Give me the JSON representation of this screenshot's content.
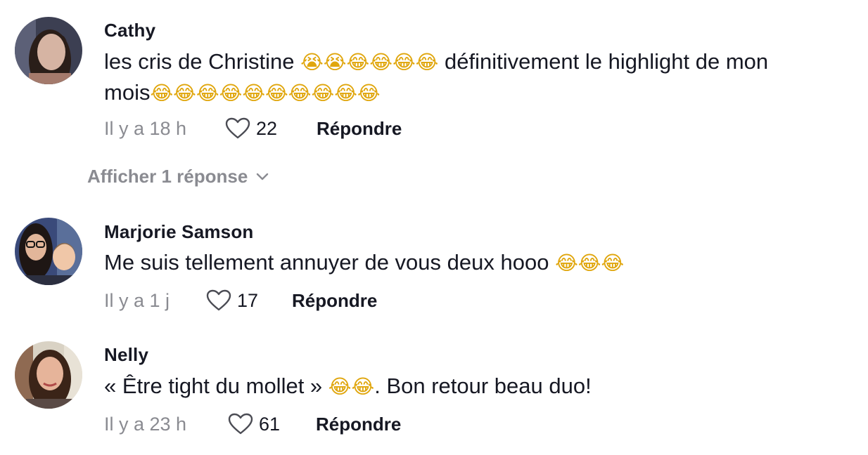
{
  "comments": [
    {
      "username": "Cathy",
      "text_line1": "les cris de Christine ",
      "emojis_a": "😭😭😂😂😂😂",
      "text_line1b": " définitivement le highlight de mon",
      "text_line2": "mois",
      "emojis_b": "😂😂😂😂😂😂😂😂😂😂",
      "time": "Il y a 18 h",
      "likes": "22",
      "reply": "Répondre"
    },
    {
      "username": "Marjorie Samson",
      "text": "Me suis tellement annuyer de vous deux hooo ",
      "emojis": "😂😂😂",
      "time": "Il y a 1 j",
      "likes": "17",
      "reply": "Répondre"
    },
    {
      "username": "Nelly",
      "text": "« Être tight du mollet » ",
      "emojis": "😂😂",
      "text_after": ". Bon retour beau duo!",
      "time": "Il y a 23 h",
      "likes": "61",
      "reply": "Répondre"
    }
  ],
  "show_replies": "Afficher 1 réponse",
  "icons": {
    "like": "heart-outline-icon",
    "expand": "chevron-down-icon"
  },
  "colors": {
    "text": "#161823",
    "secondary": "#8a8b91",
    "emoji": "#e0a60d"
  }
}
